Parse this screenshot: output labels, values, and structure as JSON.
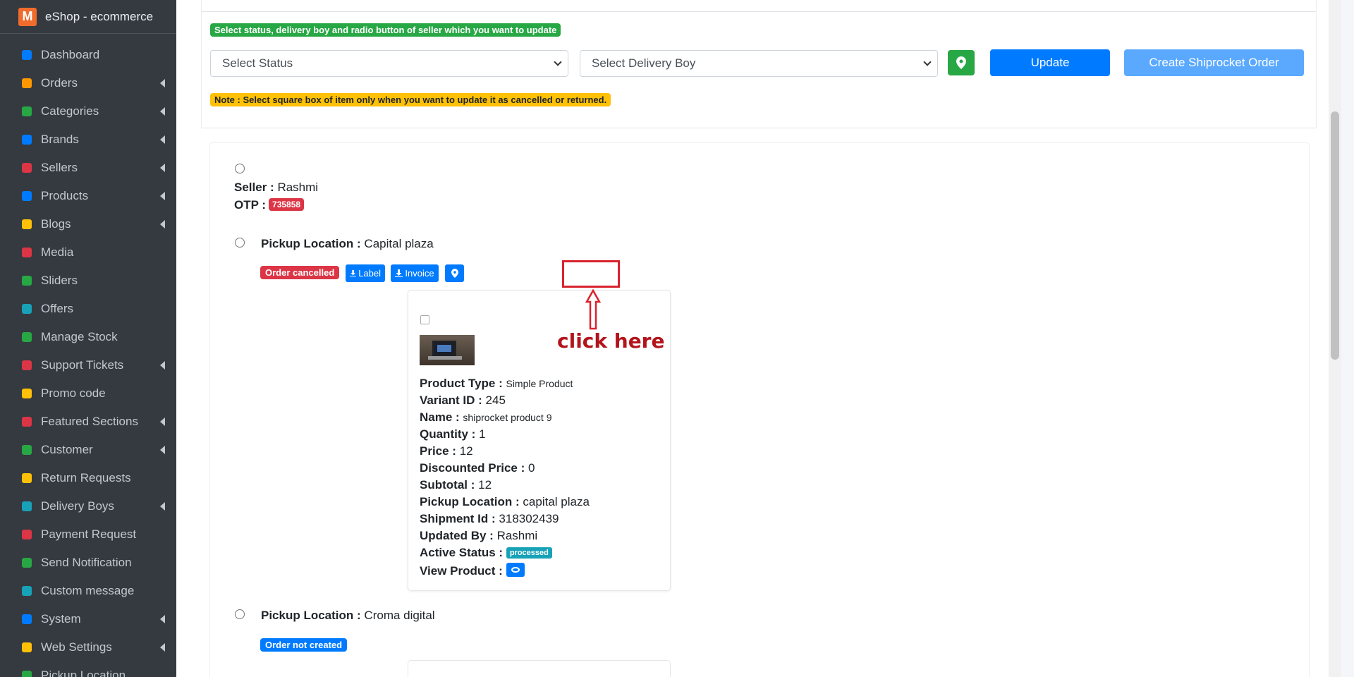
{
  "app": {
    "title": "eShop - ecommerce",
    "logo_letter": "M"
  },
  "sidebar": {
    "items": [
      {
        "label": "Dashboard",
        "icon": "dashboard-icon",
        "color": "#007bff",
        "caret": false
      },
      {
        "label": "Orders",
        "icon": "cart-icon",
        "color": "#ff9800",
        "caret": true
      },
      {
        "label": "Categories",
        "icon": "target-icon",
        "color": "#28a745",
        "caret": true
      },
      {
        "label": "Brands",
        "icon": "brand-icon",
        "color": "#007bff",
        "caret": true
      },
      {
        "label": "Sellers",
        "icon": "store-icon",
        "color": "#dc3545",
        "caret": true
      },
      {
        "label": "Products",
        "icon": "cubes-icon",
        "color": "#007bff",
        "caret": true
      },
      {
        "label": "Blogs",
        "icon": "blog-icon",
        "color": "#ffc107",
        "caret": true
      },
      {
        "label": "Media",
        "icon": "photo-video-icon",
        "color": "#dc3545",
        "caret": false
      },
      {
        "label": "Sliders",
        "icon": "image-icon",
        "color": "#28a745",
        "caret": false
      },
      {
        "label": "Offers",
        "icon": "gift-icon",
        "color": "#17a2b8",
        "caret": false
      },
      {
        "label": "Manage Stock",
        "icon": "cube-icon",
        "color": "#28a745",
        "caret": false
      },
      {
        "label": "Support Tickets",
        "icon": "ticket-icon",
        "color": "#dc3545",
        "caret": true
      },
      {
        "label": "Promo code",
        "icon": "puzzle-icon",
        "color": "#ffc107",
        "caret": false
      },
      {
        "label": "Featured Sections",
        "icon": "layers-icon",
        "color": "#dc3545",
        "caret": true
      },
      {
        "label": "Customer",
        "icon": "user-icon",
        "color": "#28a745",
        "caret": true
      },
      {
        "label": "Return Requests",
        "icon": "undo-icon",
        "color": "#ffc107",
        "caret": false
      },
      {
        "label": "Delivery Boys",
        "icon": "id-badge-icon",
        "color": "#17a2b8",
        "caret": true
      },
      {
        "label": "Payment Request",
        "icon": "money-icon",
        "color": "#dc3545",
        "caret": false
      },
      {
        "label": "Send Notification",
        "icon": "paper-plane-icon",
        "color": "#28a745",
        "caret": false
      },
      {
        "label": "Custom message",
        "icon": "bell-icon",
        "color": "#17a2b8",
        "caret": false
      },
      {
        "label": "System",
        "icon": "wrench-icon",
        "color": "#007bff",
        "caret": true
      },
      {
        "label": "Web Settings",
        "icon": "globe-icon",
        "color": "#ffc107",
        "caret": true
      },
      {
        "label": "Pickup Location",
        "icon": "truck-icon",
        "color": "#28a745",
        "caret": false
      }
    ]
  },
  "update_bar": {
    "instruction": "Select status, delivery boy and radio button of seller which you want to update",
    "status_select": "Select Status",
    "delivery_select": "Select Delivery Boy",
    "update_label": "Update",
    "shiprocket_label": "Create Shiprocket Order",
    "note": "Note : Select square box of item only when you want to update it as cancelled or returned."
  },
  "seller": {
    "label": "Seller :",
    "name": "Rashmi",
    "otp_label": "OTP :",
    "otp": "735858"
  },
  "pickup1": {
    "label": "Pickup Location :",
    "value": "Capital plaza",
    "status": "Order cancelled",
    "label_btn": "Label",
    "invoice_btn": "Invoice"
  },
  "annotation": {
    "text": "click here"
  },
  "product": {
    "fields": [
      {
        "label": "Product Type :",
        "value": "Simple Product",
        "small": true
      },
      {
        "label": "Variant ID :",
        "value": "245"
      },
      {
        "label": "Name :",
        "value": "shiprocket product 9",
        "small": true
      },
      {
        "label": "Quantity :",
        "value": "1"
      },
      {
        "label": "Price :",
        "value": "12"
      },
      {
        "label": "Discounted Price :",
        "value": "0"
      },
      {
        "label": "Subtotal :",
        "value": "12"
      },
      {
        "label": "Pickup Location :",
        "value": "capital plaza"
      },
      {
        "label": "Shipment Id :",
        "value": "318302439"
      },
      {
        "label": "Updated By :",
        "value": "Rashmi"
      }
    ],
    "active_status_label": "Active Status :",
    "active_status": "processed",
    "view_label": "View Product :"
  },
  "pickup2": {
    "label": "Pickup Location :",
    "value": "Croma digital",
    "status": "Order not created"
  }
}
